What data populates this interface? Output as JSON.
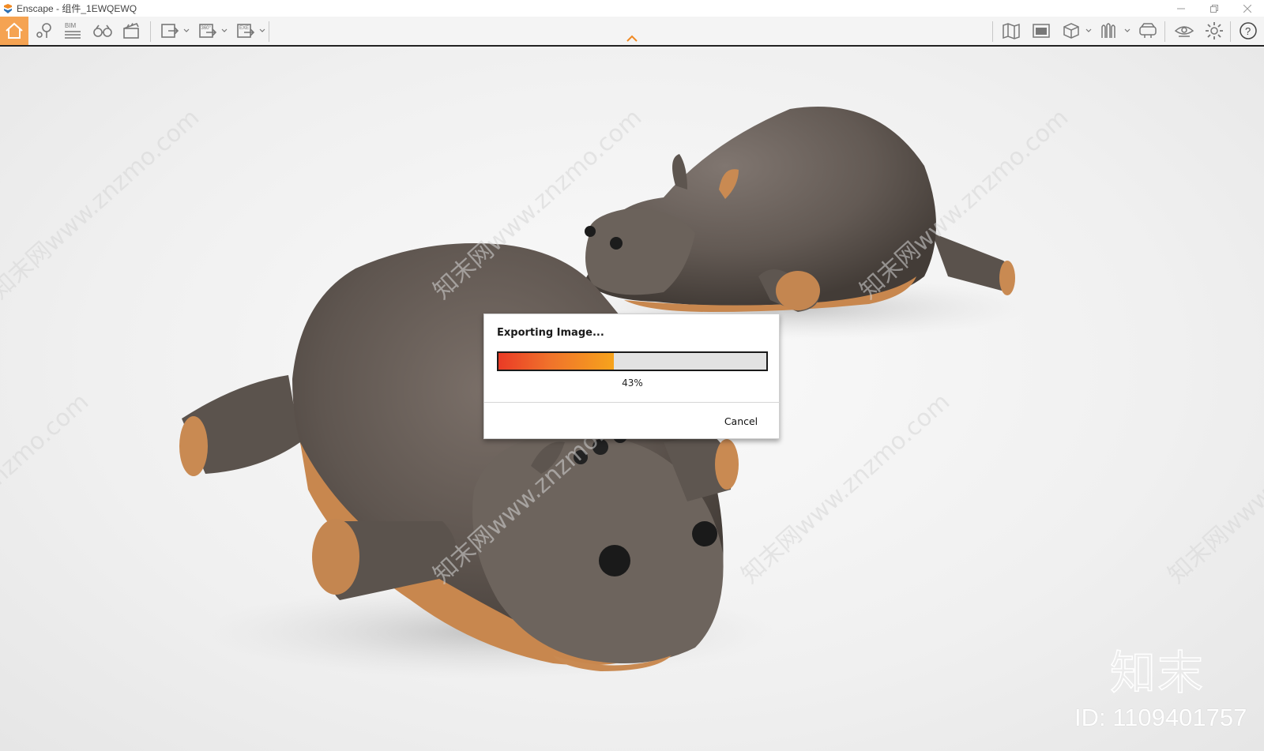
{
  "window": {
    "title": "Enscape - 组件_1EWQEWQ",
    "controls": [
      "minimize",
      "restore",
      "close"
    ]
  },
  "toolbar": {
    "left_buttons": [
      {
        "name": "home-icon",
        "active": true
      },
      {
        "name": "location-pin-icon"
      },
      {
        "name": "bim-icon",
        "label": "BIM"
      },
      {
        "name": "binoculars-icon"
      },
      {
        "name": "clapperboard-icon"
      },
      {
        "name": "screenshot-export-icon"
      },
      {
        "name": "panorama-360-icon",
        "label": "360°"
      },
      {
        "name": "exe-export-icon",
        "label": "EXE"
      }
    ],
    "right_buttons": [
      {
        "name": "map-icon"
      },
      {
        "name": "scene-list-icon"
      },
      {
        "name": "cube-view-icon"
      },
      {
        "name": "asset-library-icon"
      },
      {
        "name": "vr-headset-icon"
      },
      {
        "name": "visibility-eye-icon"
      },
      {
        "name": "settings-gear-icon"
      },
      {
        "name": "help-icon",
        "label": "?"
      }
    ],
    "accent_color": "#f5a352"
  },
  "dialog": {
    "title": "Exporting Image...",
    "progress": 0.43,
    "progress_label": "43%",
    "cancel_label": "Cancel",
    "progress_colors": [
      "#ea3b26",
      "#f6a31c"
    ]
  },
  "watermark": {
    "text": "知末网www.znzmo.com",
    "brand": "知末",
    "id_label": "ID: 1109401757"
  }
}
